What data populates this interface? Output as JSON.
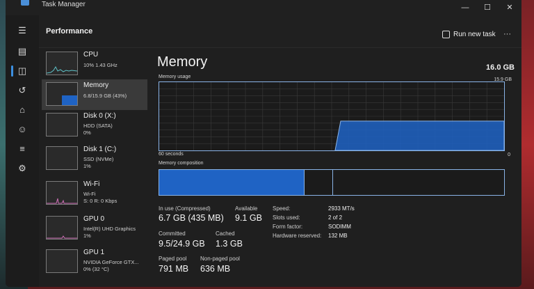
{
  "window": {
    "title": "Task Manager",
    "minimize": "—",
    "maximize": "☐",
    "close": "✕"
  },
  "rail": {
    "icons": [
      "menu-icon",
      "processes-icon",
      "performance-icon",
      "app-history-icon",
      "startup-icon",
      "users-icon",
      "details-icon",
      "services-icon",
      "settings-icon"
    ]
  },
  "header": {
    "title": "Performance",
    "run_task": "Run new task",
    "more": "···"
  },
  "devices": [
    {
      "name": "CPU",
      "sub1": "10% 1.43 GHz",
      "sub2": ""
    },
    {
      "name": "Memory",
      "sub1": "6.8/15.9 GB (43%)",
      "sub2": ""
    },
    {
      "name": "Disk 0 (X:)",
      "sub1": "HDD (SATA)",
      "sub2": "0%"
    },
    {
      "name": "Disk 1 (C:)",
      "sub1": "SSD (NVMe)",
      "sub2": "1%"
    },
    {
      "name": "Wi-Fi",
      "sub1": "Wi-Fi",
      "sub2": "S: 0 R: 0 Kbps"
    },
    {
      "name": "GPU 0",
      "sub1": "Intel(R) UHD Graphics",
      "sub2": "1%"
    },
    {
      "name": "GPU 1",
      "sub1": "NVIDIA GeForce GTX...",
      "sub2": "0% (32 °C)"
    }
  ],
  "memory": {
    "title": "Memory",
    "total": "16.0 GB",
    "usage_label": "Memory usage",
    "usage_max": "15.9 GB",
    "time_label": "60 seconds",
    "zero_label": "0",
    "usage_fraction": 0.43,
    "composition_label": "Memory composition",
    "composition_in_use_fraction": 0.42,
    "composition_modified_fraction": 0.08,
    "in_use_label": "In use (Compressed)",
    "in_use_value": "6.7 GB (435 MB)",
    "available_label": "Available",
    "available_value": "9.1 GB",
    "committed_label": "Committed",
    "committed_value": "9.5/24.9 GB",
    "cached_label": "Cached",
    "cached_value": "1.3 GB",
    "paged_label": "Paged pool",
    "paged_value": "791 MB",
    "nonpaged_label": "Non-paged pool",
    "nonpaged_value": "636 MB",
    "speed_label": "Speed:",
    "speed_value": "2933 MT/s",
    "slots_label": "Slots used:",
    "slots_value": "2 of 2",
    "form_label": "Form factor:",
    "form_value": "SODIMM",
    "hw_label": "Hardware reserved:",
    "hw_value": "132 MB"
  },
  "colors": {
    "accent": "#3c8fe0",
    "fill": "#1f63c4",
    "border": "#8ab4e8"
  }
}
